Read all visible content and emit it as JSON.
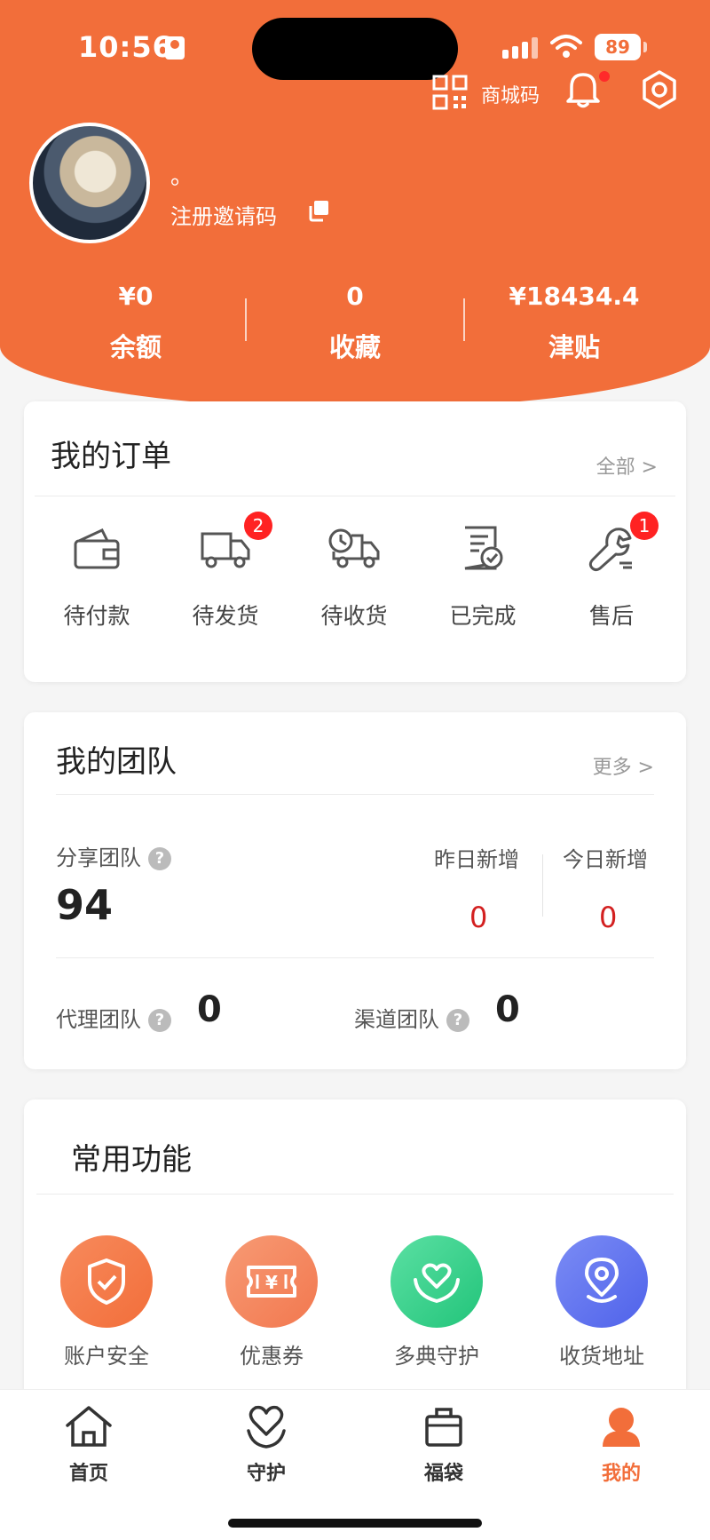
{
  "status_bar": {
    "time": "10:56",
    "battery": "89"
  },
  "header": {
    "qr_label": "商城码",
    "nickname": "。",
    "invite_label": "注册邀请码",
    "stats": [
      {
        "value": "¥0",
        "label": "余额"
      },
      {
        "value": "0",
        "label": "收藏"
      },
      {
        "value": "¥18434.4",
        "label": "津贴"
      }
    ]
  },
  "orders": {
    "title": "我的订单",
    "more": "全部 >",
    "items": [
      {
        "label": "待付款",
        "icon": "wallet-icon",
        "badge": ""
      },
      {
        "label": "待发货",
        "icon": "truck-icon",
        "badge": "2"
      },
      {
        "label": "待收货",
        "icon": "delivery-truck-icon",
        "badge": ""
      },
      {
        "label": "已完成",
        "icon": "completed-doc-icon",
        "badge": ""
      },
      {
        "label": "售后",
        "icon": "wrench-icon",
        "badge": "1"
      }
    ]
  },
  "team": {
    "title": "我的团队",
    "more": "更多 >",
    "share_label": "分享团队",
    "share_value": "94",
    "yesterday_label": "昨日新增",
    "yesterday_value": "0",
    "today_label": "今日新增",
    "today_value": "0",
    "agent_label": "代理团队",
    "agent_value": "0",
    "channel_label": "渠道团队",
    "channel_value": "0"
  },
  "functions": {
    "title": "常用功能",
    "items": [
      {
        "label": "账户安全",
        "icon": "shield-icon",
        "color": "#f26e3a"
      },
      {
        "label": "优惠券",
        "icon": "coupon-icon",
        "color": "#f2784f"
      },
      {
        "label": "多典守护",
        "icon": "heart-hands-icon",
        "color": "#34d18a"
      },
      {
        "label": "收货地址",
        "icon": "location-icon",
        "color": "#5a6ff0"
      }
    ]
  },
  "tabbar": {
    "items": [
      {
        "label": "首页",
        "icon": "home-icon"
      },
      {
        "label": "守护",
        "icon": "heart-icon"
      },
      {
        "label": "福袋",
        "icon": "bag-icon"
      },
      {
        "label": "我的",
        "icon": "user-icon",
        "active": true
      }
    ]
  },
  "colors": {
    "accent": "#f26e3a",
    "badge": "#ff2222",
    "highlight_num": "#d32020"
  }
}
